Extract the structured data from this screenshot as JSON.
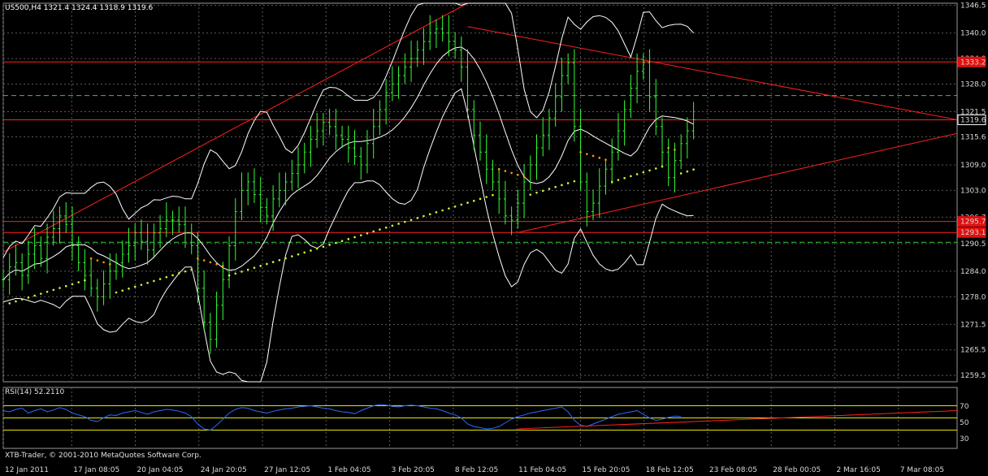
{
  "header": {
    "symbol_info": "US500,H4  1321.4 1324.4 1318.9 1319.6"
  },
  "rsi_panel": {
    "label": "RSI(14) 52.2110",
    "levels": [
      "70",
      "50",
      "30"
    ],
    "copyright": "XTB-Trader, © 2001-2010 MetaQuotes Software Corp."
  },
  "colors": {
    "background": "#000000",
    "grid": "#5a5a5a",
    "candle": "#33ff33",
    "bollinger": "#ffffff",
    "trendline": "#ff2020",
    "sar_up": "#c8ff32",
    "sar_down": "#ffa000",
    "rsi_line": "#2a6bff",
    "rsi_level": "#e6e600",
    "dashed_level": "#33cc33"
  },
  "chart_data": {
    "type": "line",
    "title": "US500,H4",
    "ylim": [
      1258.0,
      1347.0
    ],
    "y_ticks": [
      "1346.5",
      "1340.0",
      "1334.0",
      "1328.0",
      "1321.5",
      "1315.6",
      "1309.0",
      "1303.0",
      "1296.7",
      "1290.5",
      "1284.0",
      "1278.0",
      "1271.5",
      "1265.5",
      "1259.5"
    ],
    "x_ticks": [
      "12 Jan 2011",
      "17 Jan 08:05",
      "20 Jan 04:05",
      "24 Jan 20:05",
      "27 Jan 12:05",
      "1 Feb 04:05",
      "3 Feb 20:05",
      "8 Feb 12:05",
      "11 Feb 04:05",
      "15 Feb 20:05",
      "18 Feb 12:05",
      "23 Feb 08:05",
      "28 Feb 00:05",
      "2 Mar 16:05",
      "7 Mar 08:05"
    ],
    "price_labels": [
      {
        "value": 1333.2,
        "text": "1333.2"
      },
      {
        "value": 1319.6,
        "text": "1319.6"
      },
      {
        "value": 1295.7,
        "text": "1295.7"
      },
      {
        "value": 1293.1,
        "text": "1293.1"
      }
    ],
    "horizontal_lines": [
      1333.2,
      1319.6,
      1295.7,
      1293.1
    ],
    "dashed_levels": [
      1325.3,
      1290.8
    ],
    "close_series": [
      1282,
      1285,
      1286,
      1283,
      1288,
      1290,
      1287,
      1292,
      1294,
      1297,
      1295,
      1290,
      1286,
      1283,
      1280,
      1278,
      1281,
      1284,
      1286,
      1288,
      1290,
      1293,
      1291,
      1289,
      1293,
      1294,
      1296,
      1296,
      1295,
      1293,
      1290,
      1280,
      1272,
      1268,
      1276,
      1282,
      1290,
      1298,
      1303,
      1305,
      1302,
      1299,
      1297,
      1301,
      1303,
      1305,
      1307,
      1309,
      1312,
      1315,
      1317,
      1319,
      1318,
      1316,
      1315,
      1313,
      1311,
      1309,
      1314,
      1318,
      1322,
      1326,
      1328,
      1330,
      1332,
      1334,
      1336,
      1338,
      1340,
      1341,
      1340,
      1338,
      1336,
      1332,
      1322,
      1316,
      1312,
      1308,
      1305,
      1301,
      1297,
      1296,
      1300,
      1305,
      1309,
      1313,
      1316,
      1320,
      1325,
      1330,
      1333,
      1318,
      1305,
      1298,
      1300,
      1304,
      1308,
      1312,
      1317,
      1322,
      1327,
      1331,
      1333,
      1325,
      1318,
      1312,
      1306,
      1310,
      1314,
      1317,
      1319.6
    ],
    "trendlines": [
      {
        "from": [
          0,
          1288.5
        ],
        "to": [
          74,
          1347.0
        ]
      },
      {
        "from": [
          74,
          1341.5
        ],
        "to": [
          152,
          1319.6
        ]
      },
      {
        "from": [
          82,
          1293.1
        ],
        "to": [
          152,
          1316.4
        ]
      }
    ],
    "rsi": {
      "ylim": [
        0,
        100
      ],
      "levels": [
        70,
        50,
        30
      ],
      "last_value": 52.211,
      "values": [
        62,
        60,
        64,
        66,
        58,
        62,
        65,
        60,
        63,
        67,
        64,
        58,
        55,
        52,
        46,
        44,
        50,
        55,
        54,
        58,
        60,
        62,
        59,
        56,
        60,
        62,
        64,
        63,
        61,
        58,
        52,
        40,
        32,
        30,
        38,
        48,
        58,
        64,
        67,
        66,
        62,
        60,
        58,
        61,
        63,
        65,
        66,
        68,
        69,
        70,
        68,
        66,
        65,
        62,
        60,
        59,
        57,
        62,
        66,
        70,
        72,
        71,
        69,
        68,
        70,
        71,
        70,
        68,
        66,
        65,
        62,
        58,
        55,
        50,
        40,
        36,
        34,
        32,
        33,
        36,
        42,
        48,
        52,
        55,
        58,
        60,
        62,
        64,
        66,
        68,
        60,
        46,
        38,
        36,
        40,
        44,
        48,
        52,
        56,
        58,
        60,
        62,
        56,
        50,
        46,
        48,
        51,
        53,
        52.211
      ],
      "trend": {
        "from": [
          82,
          32.0
        ],
        "to": [
          152,
          62.0
        ]
      }
    }
  }
}
